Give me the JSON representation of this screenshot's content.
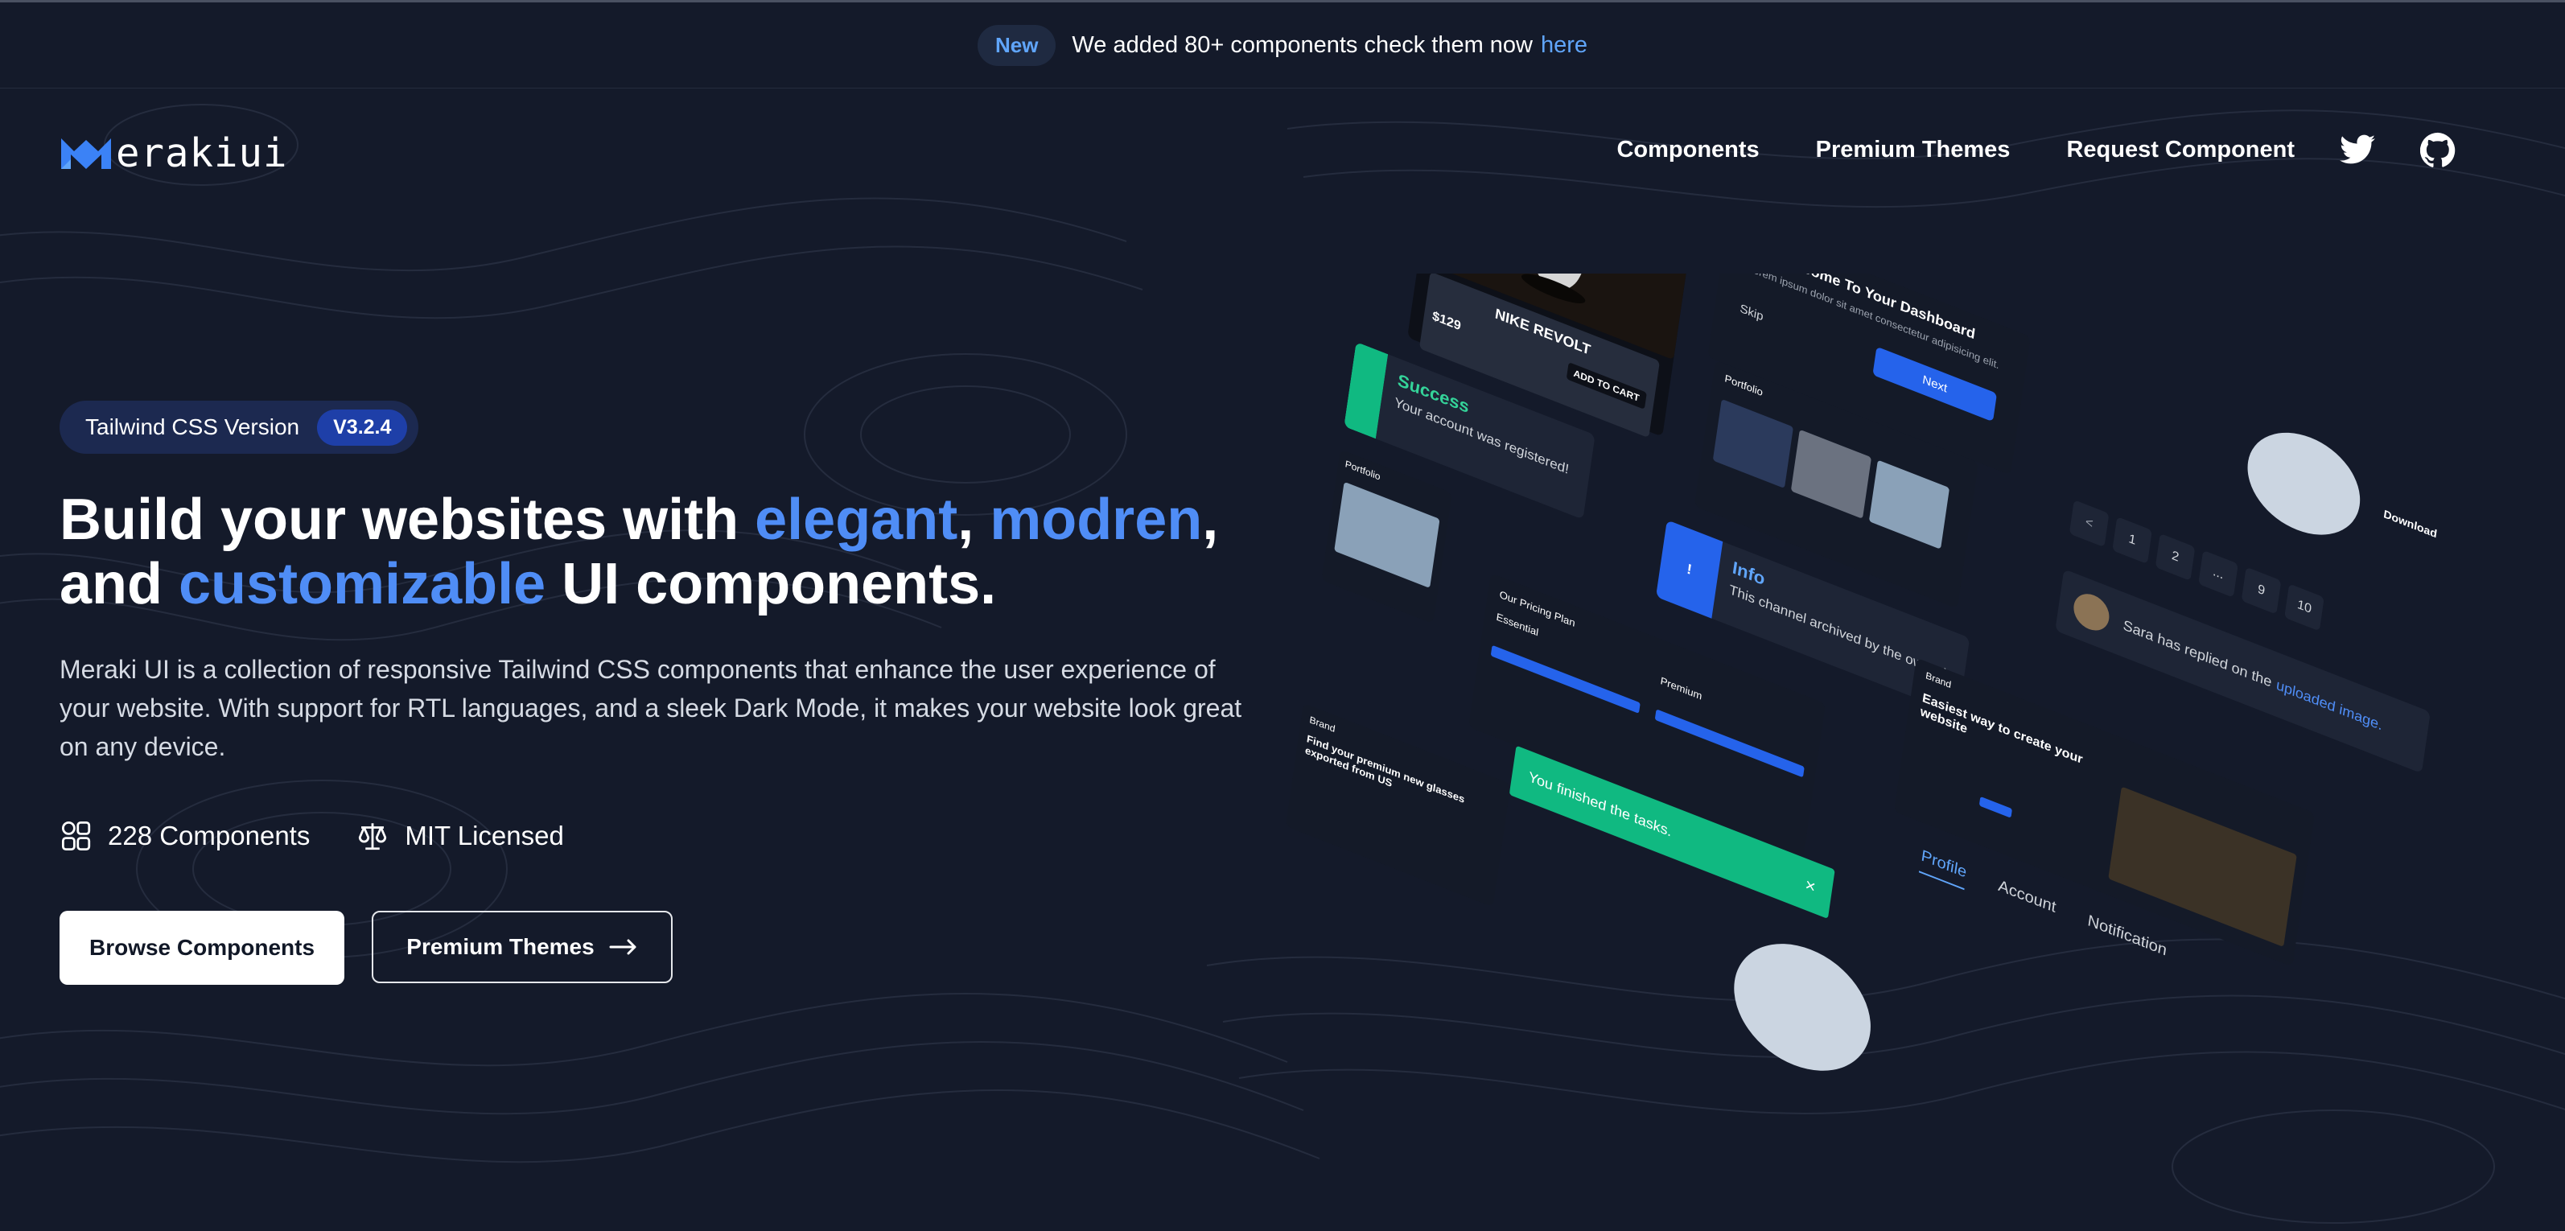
{
  "announcement": {
    "badge": "New",
    "text": "We added 80+ components check them now",
    "link": "here"
  },
  "brand": {
    "name": "erakiui"
  },
  "nav": {
    "links": [
      "Components",
      "Premium Themes",
      "Request Component"
    ],
    "icons": [
      "twitter-icon",
      "github-icon"
    ]
  },
  "hero": {
    "version_label": "Tailwind CSS Version",
    "version_value": "V3.2.4",
    "title_part1": "Build your websites with ",
    "title_elegant": "elegant",
    "title_comma1": ", ",
    "title_modren": "modren",
    "title_comma2": ",",
    "title_part2": "and ",
    "title_custom": "customizable",
    "title_part3": " UI components.",
    "description": "Meraki UI is a collection of responsive Tailwind CSS components that enhance the user experience of your website. With support for RTL languages, and a sleek Dark Mode, it makes your website look great on any device.",
    "stats": [
      {
        "label": "228 Components",
        "icon": "grid-icon"
      },
      {
        "label": "MIT Licensed",
        "icon": "scale-icon"
      }
    ],
    "primary_button": "Browse Components",
    "secondary_button": "Premium Themes"
  },
  "showcase": {
    "product_name": "NIKE REVOLT",
    "product_price": "$129",
    "add_to_cart": "ADD TO CART",
    "dashboard_title": "Welcome To Your Dashboard",
    "skip": "Skip",
    "next": "Next",
    "portfolio": "Portfolio",
    "success_title": "Success",
    "success_text": "Your account was registered!",
    "info_title": "Info",
    "info_text": "This channel archived by the owner!",
    "pages": [
      "<",
      "1",
      "2",
      "...",
      "9",
      "10"
    ],
    "reply_text": "Sara has replied on the",
    "reply_link": "uploaded image.",
    "toast_text": "You finished the tasks.",
    "pricing_title": "Our Pricing Plan",
    "plan_essential": "Essential",
    "plan_premium": "Premium",
    "hero_title": "Easiest way to create your website",
    "tabs": [
      "Profile",
      "Account",
      "Notification"
    ],
    "download": "Download",
    "brand": "Brand",
    "find_premium": "Find your premium new glasses exported from US"
  }
}
